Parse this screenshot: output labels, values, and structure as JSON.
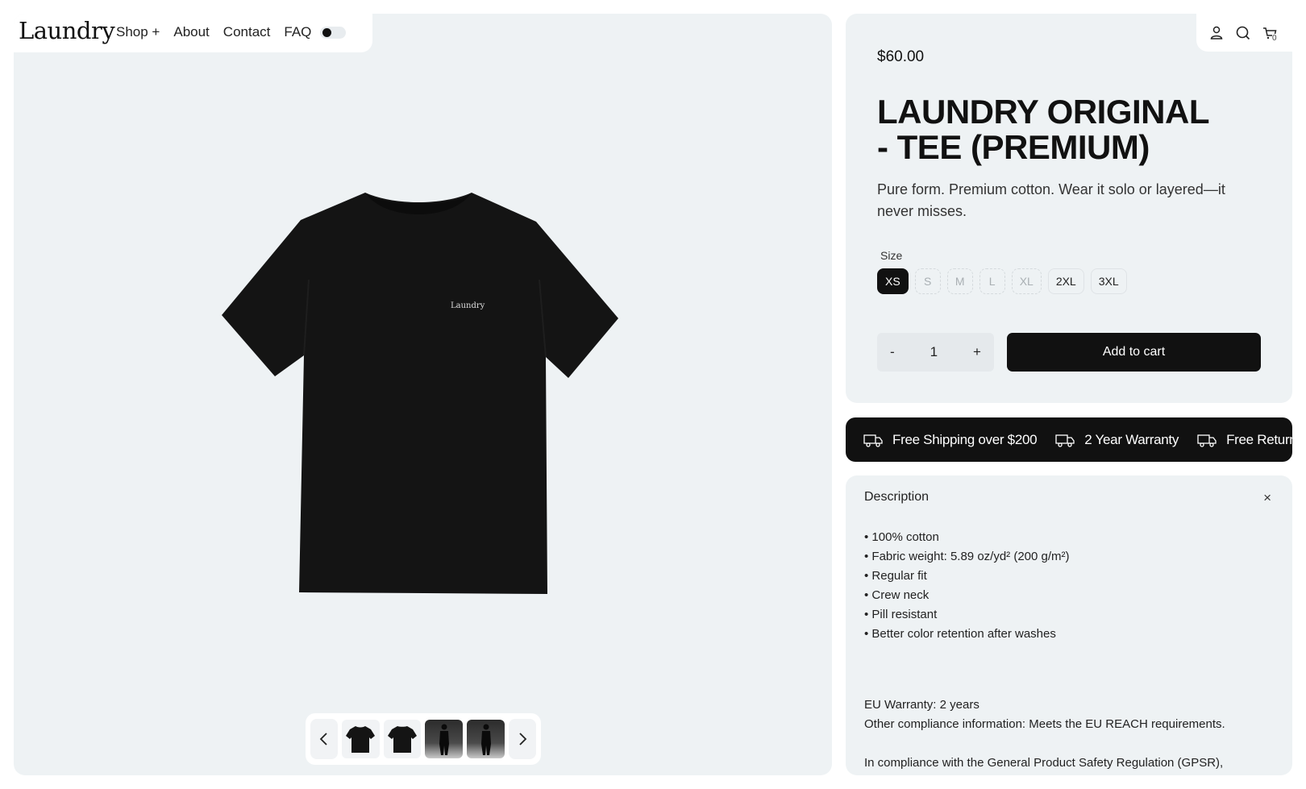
{
  "brand": "Laundry",
  "nav": {
    "shop": "Shop +",
    "about": "About",
    "contact": "Contact",
    "faq": "FAQ"
  },
  "cart_count": "0",
  "product": {
    "price": "$60.00",
    "title_line1": "LAUNDRY ORIGINAL",
    "title_line2": "- TEE (PREMIUM)",
    "description": "Pure form. Premium cotton. Wear it solo or layered—it never misses.",
    "shirt_print": "Laundry",
    "color": "#121212"
  },
  "sizes": {
    "label": "Size",
    "options": [
      {
        "label": "XS",
        "state": "selected"
      },
      {
        "label": "S",
        "state": "unavailable"
      },
      {
        "label": "M",
        "state": "unavailable"
      },
      {
        "label": "L",
        "state": "unavailable"
      },
      {
        "label": "XL",
        "state": "unavailable"
      },
      {
        "label": "2XL",
        "state": "available"
      },
      {
        "label": "3XL",
        "state": "available"
      }
    ]
  },
  "quantity": {
    "minus": "-",
    "value": "1",
    "plus": "+"
  },
  "add_to_cart": "Add to cart",
  "perks": [
    "Free Shipping over $200",
    "2 Year Warranty",
    "Free Returns"
  ],
  "details": {
    "heading": "Description",
    "close": "×",
    "features": [
      "• 100% cotton",
      "• Fabric weight: 5.89 oz/yd² (200 g/m²)",
      "• Regular fit",
      "• Crew neck",
      "• Pill resistant",
      "• Better color retention after washes"
    ],
    "warranty": "EU Warranty: 2 years",
    "compliance": "Other compliance information: Meets the EU REACH requirements.",
    "gpsr": "In compliance with the General Product Safety Regulation (GPSR),"
  },
  "gallery": {
    "thumbnails": [
      "tee-front",
      "tee-back",
      "model-front",
      "model-back"
    ]
  },
  "icons": [
    "account-icon",
    "search-icon",
    "cart-icon",
    "truck-icon",
    "chevron-left-icon",
    "chevron-right-icon",
    "close-icon"
  ]
}
